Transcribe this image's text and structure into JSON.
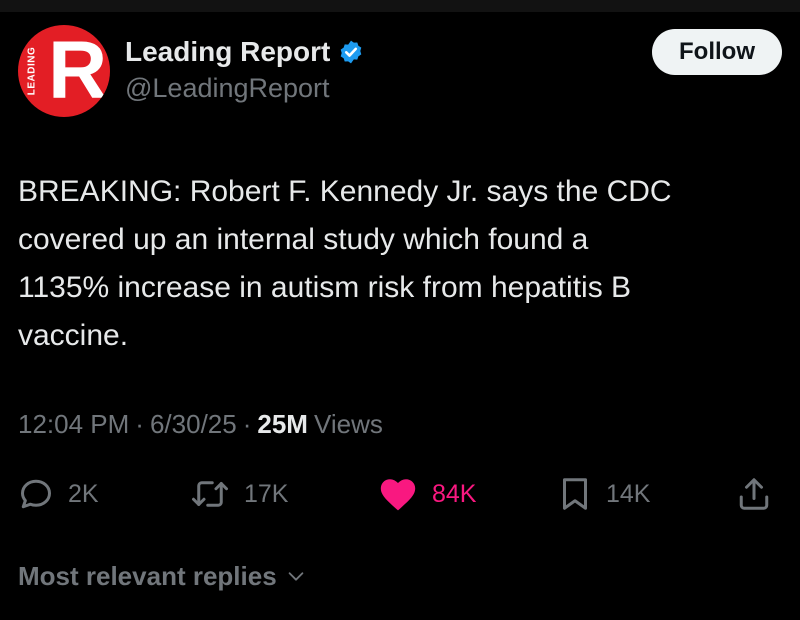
{
  "author": {
    "display_name": "Leading Report",
    "handle": "@LeadingReport",
    "avatar_letter": "R",
    "avatar_side_text": "LEADING",
    "verified": true
  },
  "follow_label": "Follow",
  "tweet": {
    "text": "BREAKING: Robert F. Kennedy Jr. says the CDC\ncovered up an internal study which found a\n1135% increase in autism risk from hepatitis B\nvaccine.",
    "time": "12:04 PM",
    "date": "6/30/25",
    "views_count": "25M",
    "views_label": "Views"
  },
  "actions": {
    "replies": "2K",
    "reposts": "17K",
    "likes": "84K",
    "bookmarks": "14K"
  },
  "replies_sort_label": "Most relevant replies",
  "colors": {
    "background": "#000000",
    "text": "#e7e9ea",
    "secondary": "#71767b",
    "like": "#f91880",
    "verified": "#1d9bf0",
    "avatar": "#e31e25"
  },
  "icons": [
    "verified-badge-icon",
    "reply-icon",
    "repost-icon",
    "like-icon",
    "bookmark-icon",
    "share-icon",
    "chevron-down-icon"
  ]
}
